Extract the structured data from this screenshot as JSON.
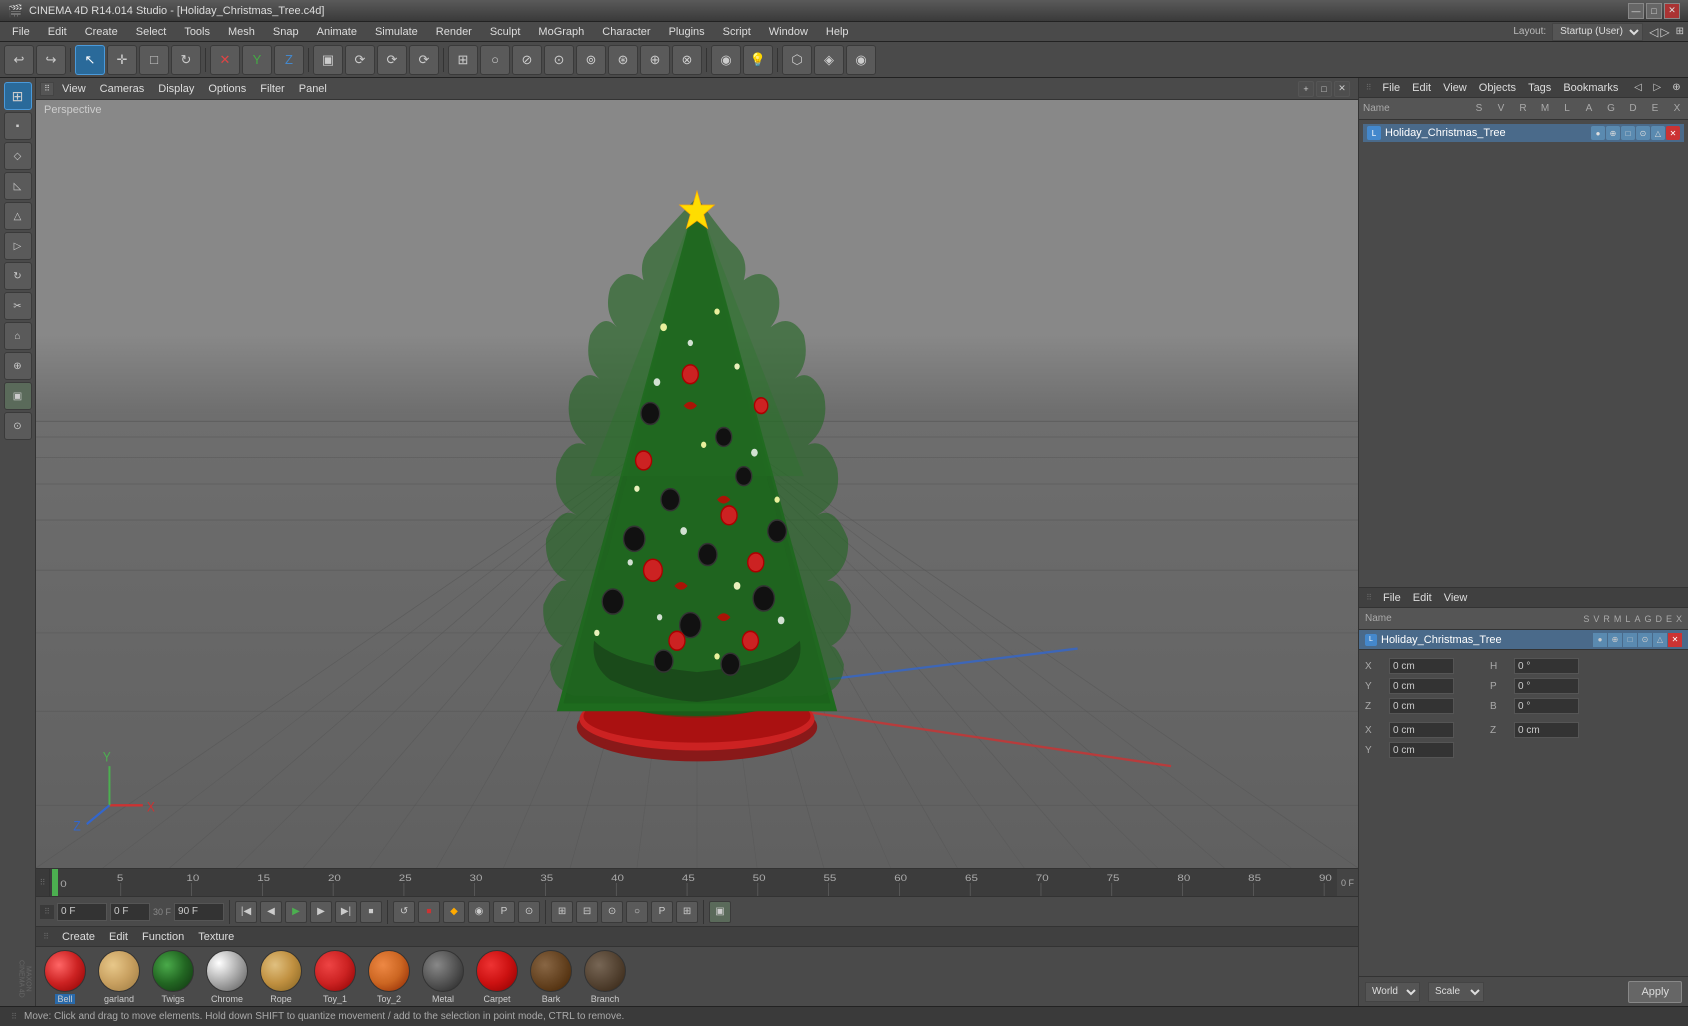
{
  "app": {
    "title": "CINEMA 4D R14.014 Studio - [Holiday_Christmas_Tree.c4d]",
    "layout_label": "Layout:",
    "layout_value": "Startup (User)"
  },
  "title_bar": {
    "app_icon": "🎬",
    "title": "CINEMA 4D R14.014 Studio - [Holiday_Christmas_Tree.c4d]",
    "minimize_label": "—",
    "restore_label": "□",
    "close_label": "✕"
  },
  "menu": {
    "items": [
      "File",
      "Edit",
      "Create",
      "Select",
      "Tools",
      "Mesh",
      "Snap",
      "Animate",
      "Simulate",
      "Render",
      "Sculpt",
      "MoGraph",
      "Character",
      "Plugins",
      "Script",
      "Window",
      "Help"
    ]
  },
  "toolbar": {
    "tools": [
      "↩",
      "↪",
      "↖",
      "✛",
      "□",
      "↻",
      "✕",
      "Y",
      "Z",
      "▣",
      "⟳",
      "⟳",
      "⟳",
      "⊞",
      "⊡",
      "⊘",
      "⊙",
      "⊚",
      "⊛",
      "⊕",
      "⊗",
      "●",
      "◉",
      "○",
      "⬡",
      "◈",
      "💡"
    ]
  },
  "left_toolbar": {
    "tools": [
      "⊞",
      "⊟",
      "⊠",
      "⊡",
      "△",
      "▷",
      "◁",
      "▽",
      "⌂",
      "⊕",
      "⊖",
      "⊗"
    ]
  },
  "viewport": {
    "perspective_label": "Perspective",
    "menu_items": [
      "View",
      "Cameras",
      "Display",
      "Options",
      "Filter",
      "Panel"
    ],
    "corner_btns": [
      "+",
      "□",
      "✕"
    ]
  },
  "timeline": {
    "markers": [
      "0",
      "5",
      "10",
      "15",
      "20",
      "25",
      "30",
      "35",
      "40",
      "45",
      "50",
      "55",
      "60",
      "65",
      "70",
      "75",
      "80",
      "85",
      "90"
    ],
    "current_frame": "0 F",
    "end_frame": "90 F",
    "fps": "30 F"
  },
  "transport": {
    "buttons": [
      "⏮",
      "⏭",
      "◀",
      "▶",
      "⏩",
      "⏪",
      "⏹"
    ],
    "frame_input": "0 F",
    "fps_input": "30 F"
  },
  "material_editor": {
    "menu_items": [
      "Create",
      "Edit",
      "Function",
      "Texture"
    ],
    "materials": [
      {
        "name": "Bell",
        "color": "#cc3333",
        "selected": true
      },
      {
        "name": "garland",
        "color": "#d4a070",
        "selected": false
      },
      {
        "name": "Twigs",
        "color": "#2a7a2a",
        "selected": false
      },
      {
        "name": "Chrome",
        "color": "#aaaaaa",
        "selected": false
      },
      {
        "name": "Rope",
        "color": "#c8a060",
        "selected": false
      },
      {
        "name": "Toy_1",
        "color": "#cc3333",
        "selected": false
      },
      {
        "name": "Toy_2",
        "color": "#cc6622",
        "selected": false
      },
      {
        "name": "Metal",
        "color": "#555555",
        "selected": false
      },
      {
        "name": "Carpet",
        "color": "#cc2222",
        "selected": false
      },
      {
        "name": "Bark",
        "color": "#663322",
        "selected": false
      },
      {
        "name": "Branch",
        "color": "#4a3322",
        "selected": false
      }
    ]
  },
  "right_panel": {
    "top_menu": [
      "File",
      "Edit",
      "View",
      "Objects",
      "Tags",
      "Bookmarks"
    ],
    "scene_object": "Holiday_Christmas_Tree",
    "object_icon_color": "#4488cc",
    "bottom_menu": [
      "File",
      "Edit",
      "View"
    ],
    "attr_columns": [
      "Name",
      "S",
      "V",
      "R",
      "M",
      "L",
      "A",
      "G",
      "D",
      "E",
      "X"
    ],
    "attr_object_name": "Holiday_Christmas_Tree",
    "position": {
      "x_label": "X",
      "x_value": "0 cm",
      "y_label": "Y",
      "y_value": "0 cm",
      "z_label": "Z",
      "z_value": "0 cm",
      "h_label": "H",
      "h_value": "0 °",
      "p_label": "P",
      "p_value": "0 °",
      "b_label": "B",
      "b_value": "0 °",
      "sx_label": "X",
      "sx_value": "0 cm",
      "sy_label": "Y",
      "sy_value": "0 cm",
      "sz_label": "Z",
      "sz_value": "0 cm"
    },
    "coord_system": "World",
    "transform_mode": "Scale",
    "apply_label": "Apply"
  },
  "status_bar": {
    "text": "Move: Click and drag to move elements. Hold down SHIFT to quantize movement / add to the selection in point mode, CTRL to remove."
  }
}
